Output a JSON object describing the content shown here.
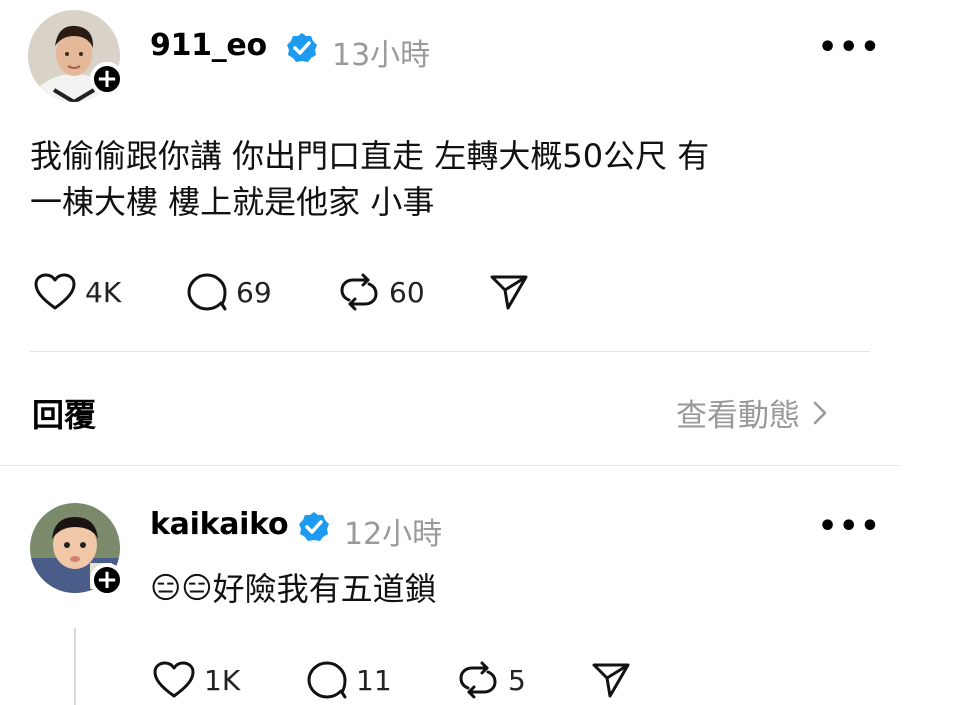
{
  "post": {
    "username": "911_eo",
    "time": "13小時",
    "text_line1": "我偷偷跟你講 你出門口直走 左轉大概50公尺 有",
    "text_line2": "一棟大樓 樓上就是他家 小事",
    "likes": "4K",
    "comments": "69",
    "reposts": "60",
    "more_label": "•••"
  },
  "replies_header": {
    "title": "回覆",
    "view_activity": "查看動態"
  },
  "reply": {
    "username": "kaikaiko",
    "time": "12小時",
    "emoji": "😑😑",
    "text": "好險我有五道鎖",
    "likes": "1K",
    "comments": "11",
    "reposts": "5",
    "more_label": "•••"
  },
  "colors": {
    "verified_badge": "#1d9bf0",
    "muted_text": "#999999",
    "divider": "#e6e6e6"
  },
  "icons": [
    "heart-icon",
    "comment-icon",
    "repost-icon",
    "share-icon",
    "verified-badge-icon",
    "more-icon",
    "follow-plus-icon",
    "chevron-right-icon"
  ]
}
